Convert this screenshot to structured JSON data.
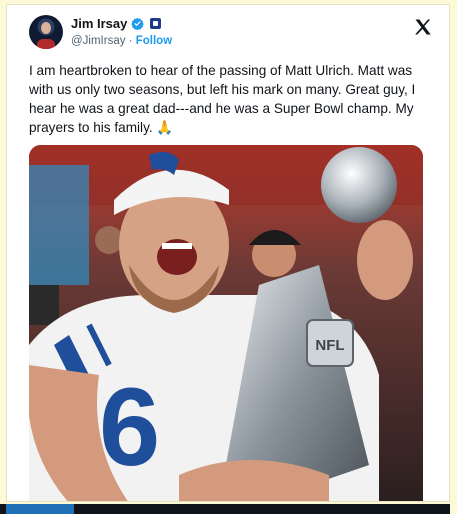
{
  "author": {
    "name": "Jim Irsay",
    "handle": "@JimIrsay",
    "separator": "·",
    "follow_label": "Follow"
  },
  "icons": [
    "avatar",
    "verified-badge-icon",
    "affiliate-badge-icon",
    "x-logo-icon"
  ],
  "tweet": {
    "text": "I am heartbroken to hear of the passing of Matt Ulrich. Matt was with us only two seasons, but left his mark on many.  Great guy, I hear he was a great dad---and he was a Super Bowl champ.  My prayers to his family. 🙏"
  },
  "media": {
    "jersey_number": "6",
    "trophy_label": "NFL"
  },
  "colors": {
    "accent": "#1d9bf0",
    "verified": "#1d9bf0",
    "text": "#0f1419",
    "muted": "#536471",
    "page_bg": "#fdf8d6"
  }
}
